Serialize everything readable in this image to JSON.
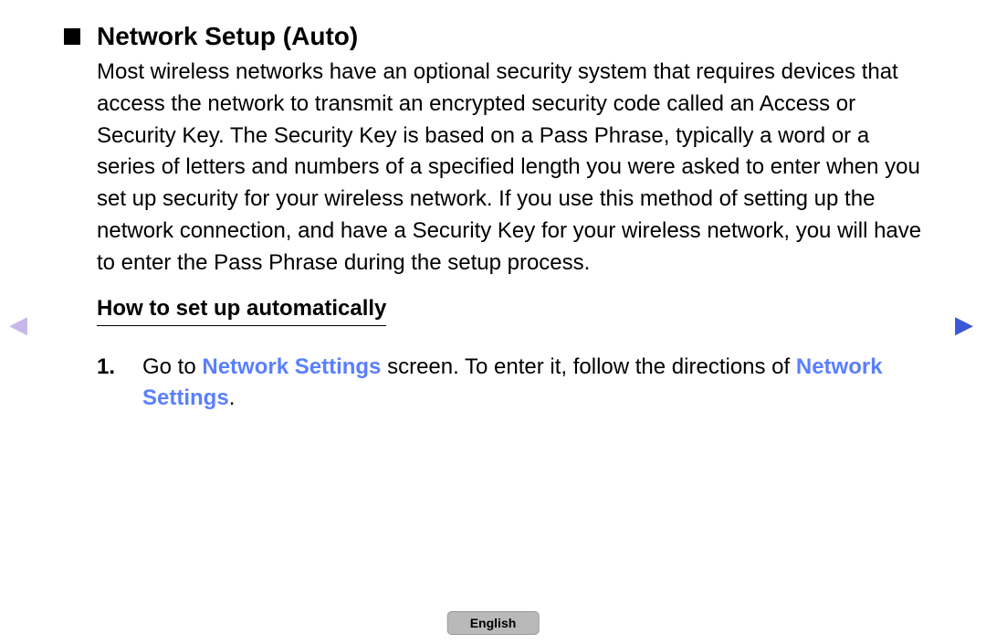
{
  "heading": "Network Setup (Auto)",
  "body": "Most wireless networks have an optional security system that requires devices that access the network to transmit an encrypted security code called an Access or Security Key. The Security Key is based on a Pass Phrase, typically a word or a series of letters and numbers of a specified length you were asked to enter when you set up security for your wireless network. If you use this method of setting up the network connection, and have a Security Key for your wireless network, you will have to enter the Pass Phrase during the setup process.",
  "subheading": "How to set up automatically",
  "step": {
    "num": "1.",
    "part1": "Go to ",
    "link1": "Network Settings",
    "part2": " screen. To enter it, follow the directions of ",
    "link2": "Network Settings",
    "part3": "."
  },
  "nav": {
    "left": "◀",
    "right": "▶"
  },
  "language": "English"
}
